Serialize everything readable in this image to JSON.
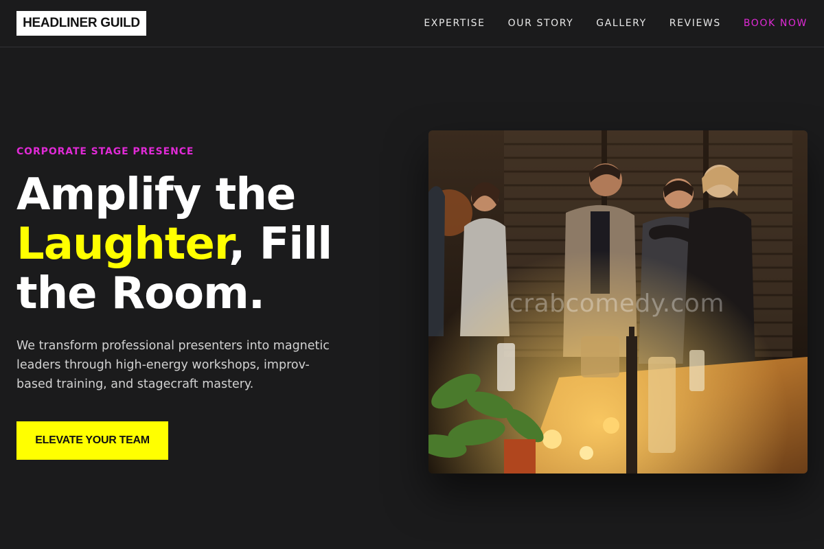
{
  "header": {
    "logo": "HEADLINER GUILD",
    "nav": [
      {
        "label": "EXPERTISE"
      },
      {
        "label": "OUR STORY"
      },
      {
        "label": "GALLERY"
      },
      {
        "label": "REVIEWS"
      },
      {
        "label": "BOOK NOW"
      }
    ]
  },
  "hero": {
    "eyebrow": "CORPORATE STAGE PRESENCE",
    "headline": {
      "line1": "Amplify the",
      "highlight": "Laughter",
      "line2_rest": ", Fill",
      "line3": "the Room."
    },
    "lede": "We transform professional presenters into magnetic leaders through high-energy workshops, improv-based training, and stagecraft mastery.",
    "cta": "ELEVATE YOUR TEAM",
    "image": {
      "watermark": "crabcomedy.com"
    }
  },
  "colors": {
    "background": "#1b1b1c",
    "accent_magenta": "#e02ad6",
    "accent_yellow": "#ffff00"
  }
}
